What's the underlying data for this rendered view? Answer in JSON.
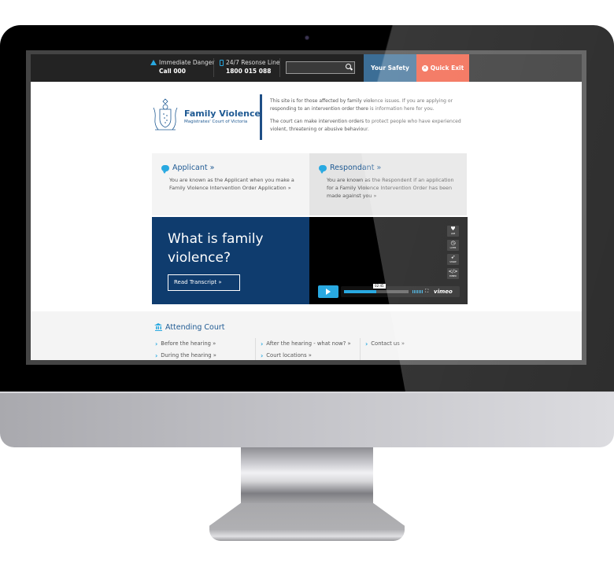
{
  "topbar": {
    "danger_label": "Immediate Danger",
    "danger_number": "Call 000",
    "response_label": "24/7 Resonse Line",
    "response_number": "1800 015 088",
    "search_placeholder": "",
    "your_safety": "Your Safety",
    "quick_exit": "Quick Exit",
    "colors": {
      "accent": "#29a9e1",
      "safety": "#3c6e96",
      "exit": "#f15a3f"
    }
  },
  "header": {
    "title": "Family Violence",
    "subtitle": "Magistrates' Court of Victoria",
    "intro_p1": "This site is for those affected by family violence issues. If you are applying or responding to an intervention order there is information here for you.",
    "intro_p2": "The court can make intervention orders to protect people who have experienced violent, threatening or abusive behaviour."
  },
  "cards": [
    {
      "title": "Applicant »",
      "text": "You are known as the Applicant when you make a Family Violence Intervention Order Application »"
    },
    {
      "title": "Respondant »",
      "text": "You are known as the Respondent if an application for a Family Violence Intervention Order has been made against you »"
    }
  ],
  "promo": {
    "title": "What is family violence?",
    "button": "Read Transcript »"
  },
  "video": {
    "time": "02:45",
    "progress": 0.5,
    "side_buttons": [
      "LIKE",
      "LATER",
      "SHARE",
      "EMBED"
    ],
    "brand": "vimeo"
  },
  "court": {
    "title": "Attending Court",
    "col1": [
      "Before the hearing »",
      "During the hearing »"
    ],
    "col2": [
      "After the hearing - what now? »",
      "Court locations »"
    ],
    "col3": [
      "Contact us »"
    ]
  }
}
